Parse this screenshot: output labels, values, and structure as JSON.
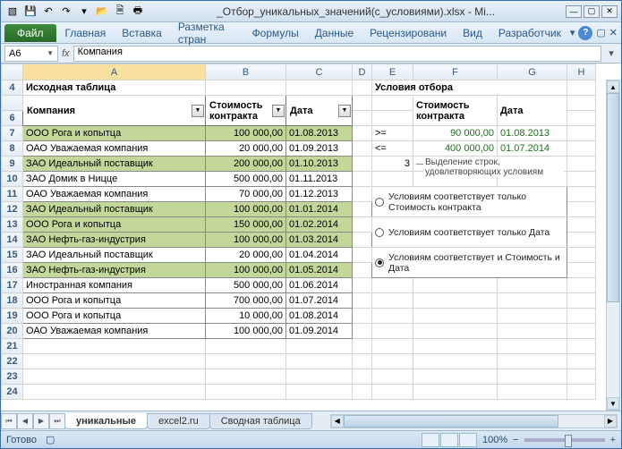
{
  "titlebar": {
    "title": "_Отбор_уникальных_значений(с_условиями).xlsx - Mi..."
  },
  "ribbon": {
    "file": "Файл",
    "tabs": [
      "Главная",
      "Вставка",
      "Разметка стран",
      "Формулы",
      "Данные",
      "Рецензировани",
      "Вид",
      "Разработчик"
    ]
  },
  "fbar": {
    "cell_ref": "A6",
    "formula": "Компания"
  },
  "columns": [
    "A",
    "B",
    "C",
    "D",
    "E",
    "F",
    "G",
    "H"
  ],
  "sheet": {
    "source_title": "Исходная таблица",
    "cond_title": "Условия отбора",
    "headers": {
      "company": "Компания",
      "cost": "Стоимость контракта",
      "date": "Дата"
    },
    "rows": [
      {
        "n": 7,
        "c": "ООО Рога и копытца",
        "v": "100 000,00",
        "d": "01.08.2013",
        "hl": true
      },
      {
        "n": 8,
        "c": "ОАО Уважаемая компания",
        "v": "20 000,00",
        "d": "01.09.2013",
        "hl": false
      },
      {
        "n": 9,
        "c": "ЗАО Идеальный поставщик",
        "v": "200 000,00",
        "d": "01.10.2013",
        "hl": true
      },
      {
        "n": 10,
        "c": "ЗАО Домик в Ницце",
        "v": "500 000,00",
        "d": "01.11.2013",
        "hl": false
      },
      {
        "n": 11,
        "c": "ОАО Уважаемая компания",
        "v": "70 000,00",
        "d": "01.12.2013",
        "hl": false
      },
      {
        "n": 12,
        "c": "ЗАО Идеальный поставщик",
        "v": "100 000,00",
        "d": "01.01.2014",
        "hl": true
      },
      {
        "n": 13,
        "c": "ООО Рога и копытца",
        "v": "150 000,00",
        "d": "01.02.2014",
        "hl": true
      },
      {
        "n": 14,
        "c": "ЗАО Нефть-газ-индустрия",
        "v": "100 000,00",
        "d": "01.03.2014",
        "hl": true
      },
      {
        "n": 15,
        "c": "ЗАО Идеальный поставщик",
        "v": "20 000,00",
        "d": "01.04.2014",
        "hl": false
      },
      {
        "n": 16,
        "c": "ЗАО Нефть-газ-индустрия",
        "v": "100 000,00",
        "d": "01.05.2014",
        "hl": true
      },
      {
        "n": 17,
        "c": "Иностранная компания",
        "v": "500 000,00",
        "d": "01.06.2014",
        "hl": false
      },
      {
        "n": 18,
        "c": "ООО Рога и копытца",
        "v": "700 000,00",
        "d": "01.07.2014",
        "hl": false
      },
      {
        "n": 19,
        "c": "ООО Рога и копытца",
        "v": "10 000,00",
        "d": "01.08.2014",
        "hl": false
      },
      {
        "n": 20,
        "c": "ОАО Уважаемая компания",
        "v": "100 000,00",
        "d": "01.09.2014",
        "hl": false
      }
    ],
    "empty_rows": [
      21,
      22,
      23,
      24
    ],
    "cond": {
      "ge": ">=",
      "le": "<=",
      "cost_lo": "90 000,00",
      "date_lo": "01.08.2013",
      "cost_hi": "400 000,00",
      "date_hi": "01.07.2014",
      "spin": "3"
    },
    "group_label": "Выделение строк, удовлетворяющих условиям",
    "radios": [
      "Условиям соответствует только Стоимость контракта",
      "Условиям соответствует только Дата",
      "Условиям соответствует и Стоимость и Дата"
    ],
    "radio_selected": 2
  },
  "sheets": {
    "tabs": [
      "уникальные",
      "excel2.ru",
      "Сводная таблица"
    ],
    "active": 0
  },
  "status": {
    "ready": "Готово",
    "zoom": "100%",
    "plus": "+",
    "minus": "−"
  }
}
